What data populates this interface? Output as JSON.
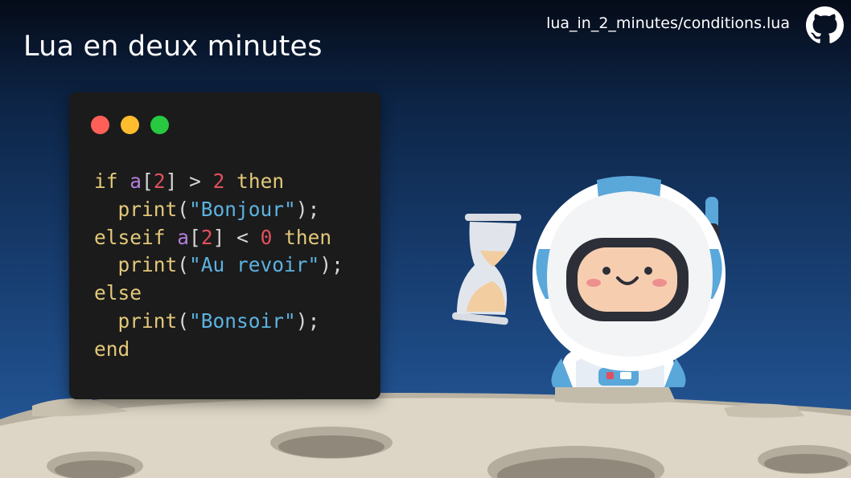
{
  "slide": {
    "title": "Lua en deux minutes",
    "file_path": "lua_in_2_minutes/conditions.lua"
  },
  "icons": {
    "github": "github-icon",
    "hourglass": "hourglass-icon",
    "astronaut": "astronaut-illustration"
  },
  "colors": {
    "traffic_red": "#fe5f57",
    "traffic_yellow": "#febc2e",
    "traffic_green": "#28c840",
    "code_bg": "#1b1b1b"
  },
  "code": {
    "lines": [
      [
        {
          "t": "if",
          "k": "keyword"
        },
        {
          "t": " ",
          "k": "op"
        },
        {
          "t": "a",
          "k": "var"
        },
        {
          "t": "[",
          "k": "op"
        },
        {
          "t": "2",
          "k": "num"
        },
        {
          "t": "] > ",
          "k": "op"
        },
        {
          "t": "2",
          "k": "num"
        },
        {
          "t": " ",
          "k": "op"
        },
        {
          "t": "then",
          "k": "keyword"
        }
      ],
      [
        {
          "t": "  ",
          "k": "op"
        },
        {
          "t": "print",
          "k": "func"
        },
        {
          "t": "(",
          "k": "op"
        },
        {
          "t": "\"Bonjour\"",
          "k": "str"
        },
        {
          "t": ");",
          "k": "op"
        }
      ],
      [
        {
          "t": "elseif",
          "k": "keyword"
        },
        {
          "t": " ",
          "k": "op"
        },
        {
          "t": "a",
          "k": "var"
        },
        {
          "t": "[",
          "k": "op"
        },
        {
          "t": "2",
          "k": "num"
        },
        {
          "t": "] < ",
          "k": "op"
        },
        {
          "t": "0",
          "k": "num"
        },
        {
          "t": " ",
          "k": "op"
        },
        {
          "t": "then",
          "k": "keyword"
        }
      ],
      [
        {
          "t": "  ",
          "k": "op"
        },
        {
          "t": "print",
          "k": "func"
        },
        {
          "t": "(",
          "k": "op"
        },
        {
          "t": "\"Au revoir\"",
          "k": "str"
        },
        {
          "t": ");",
          "k": "op"
        }
      ],
      [
        {
          "t": "else",
          "k": "keyword"
        }
      ],
      [
        {
          "t": "  ",
          "k": "op"
        },
        {
          "t": "print",
          "k": "func"
        },
        {
          "t": "(",
          "k": "op"
        },
        {
          "t": "\"Bonsoir\"",
          "k": "str"
        },
        {
          "t": ");",
          "k": "op"
        }
      ],
      [
        {
          "t": "end",
          "k": "keyword"
        }
      ]
    ]
  }
}
